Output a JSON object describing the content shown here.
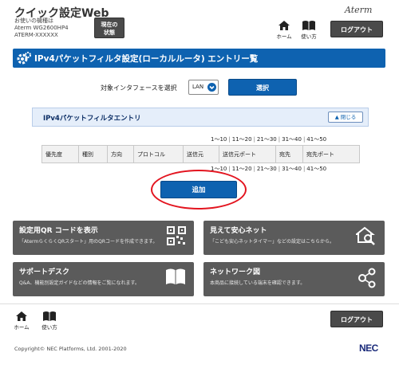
{
  "header": {
    "app_title": "クイック設定Web",
    "device_label": "お使いの機種は",
    "model": "Aterm WG2600HP4",
    "device_id": "ATERM-XXXXXX",
    "status_button": "現在の\n状態",
    "brand": "Aterm",
    "home_label": "ホーム",
    "help_label": "使い方",
    "logout_label": "ログアウト"
  },
  "page": {
    "title": "IPv4パケットフィルタ設定(ローカルルータ) エントリー覧"
  },
  "interface_select": {
    "label": "対象インタフェースを選択",
    "value": "LAN",
    "button_label": "選択"
  },
  "entry_panel": {
    "heading": "IPv4パケットフィルタエントリ",
    "collapse_label": "閉じる"
  },
  "pager": {
    "ranges": [
      "1～10",
      "11～20",
      "21～30",
      "31～40",
      "41～50"
    ]
  },
  "table": {
    "columns": [
      "優先度",
      "種別",
      "方向",
      "プロトコル",
      "送信元",
      "送信元ポート",
      "宛先",
      "宛先ポート"
    ]
  },
  "add_button_label": "追加",
  "cards": [
    {
      "title": "設定用QR コードを表示",
      "desc": "「AtermらくらくQRスタート」用のQRコードを作成できます。",
      "icon": "qr-code-icon"
    },
    {
      "title": "見えて安心ネット",
      "desc": "「こども安心ネットタイマー」などの設定はこちらから。",
      "icon": "home-search-icon"
    },
    {
      "title": "サポートデスク",
      "desc": "Q&A、機能別設定ガイドなどの情報をご覧になれます。",
      "icon": "book-icon"
    },
    {
      "title": "ネットワーク図",
      "desc": "本商品に接続している端末を確認できます。",
      "icon": "network-icon"
    }
  ],
  "footer": {
    "home_label": "ホーム",
    "help_label": "使い方",
    "logout_label": "ログアウト",
    "copyright": "Copyright© NEC Platforms, Ltd. 2001-2020",
    "brand": "NEC"
  },
  "colors": {
    "primary": "#0e62b0",
    "dark_button": "#4a4a4a",
    "card_bg": "#5b5b5b",
    "highlight_ring": "#e3141f",
    "panel_bg": "#e5eefa"
  }
}
